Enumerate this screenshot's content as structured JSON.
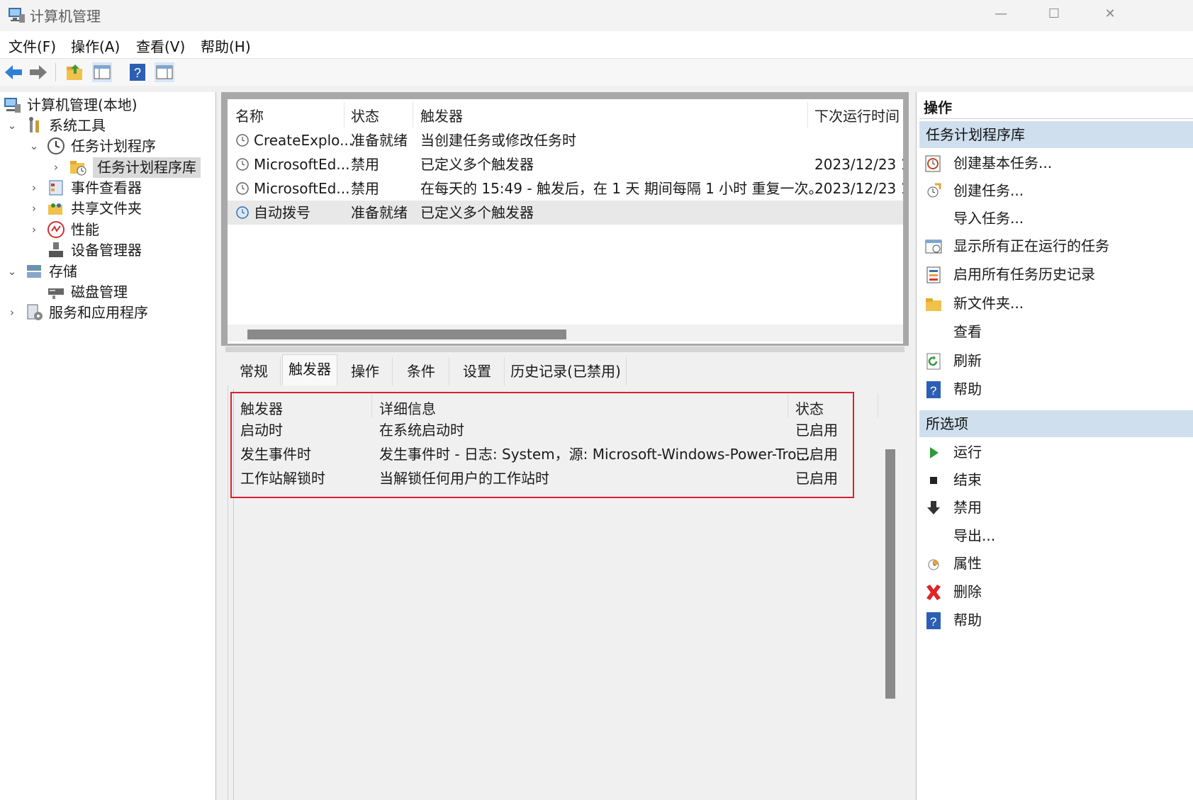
{
  "window": {
    "title": "计算机管理",
    "min": "—",
    "max": "☐",
    "close": "✕"
  },
  "menu": [
    "文件(F)",
    "操作(A)",
    "查看(V)",
    "帮助(H)"
  ],
  "tree": [
    {
      "label": "计算机管理(本地)",
      "icon": "computer-management-icon"
    },
    {
      "label": "系统工具",
      "icon": "tools-icon",
      "chevron": "⌄"
    },
    {
      "label": "任务计划程序",
      "icon": "clock-icon",
      "chevron": "⌄"
    },
    {
      "label": "任务计划程序库",
      "icon": "folder-clock-icon",
      "chevron": "›",
      "selected": true
    },
    {
      "label": "事件查看器",
      "icon": "event-viewer-icon",
      "chevron": "›"
    },
    {
      "label": "共享文件夹",
      "icon": "shared-folder-icon",
      "chevron": "›"
    },
    {
      "label": "性能",
      "icon": "performance-icon",
      "chevron": "›"
    },
    {
      "label": "设备管理器",
      "icon": "device-manager-icon"
    },
    {
      "label": "存储",
      "icon": "storage-icon",
      "chevron": "⌄"
    },
    {
      "label": "磁盘管理",
      "icon": "disk-management-icon"
    },
    {
      "label": "服务和应用程序",
      "icon": "services-icon",
      "chevron": "›"
    }
  ],
  "tasks": {
    "columns": [
      "名称",
      "状态",
      "触发器",
      "下次运行时间"
    ],
    "rows": [
      {
        "name": "CreateExplo...",
        "status": "准备就绪",
        "trigger": "当创建任务或修改任务时",
        "next": ""
      },
      {
        "name": "MicrosoftEd...",
        "status": "禁用",
        "trigger": "已定义多个触发器",
        "next": "2023/12/23 1"
      },
      {
        "name": "MicrosoftEd...",
        "status": "禁用",
        "trigger": "在每天的 15:49 - 触发后，在 1 天 期间每隔 1 小时 重复一次。",
        "next": "2023/12/23 1"
      },
      {
        "name": "自动拨号",
        "status": "准备就绪",
        "trigger": "已定义多个触发器",
        "next": "",
        "selected": true
      }
    ]
  },
  "tabs": [
    "常规",
    "触发器",
    "操作",
    "条件",
    "设置",
    "历史记录(已禁用)"
  ],
  "active_tab": "触发器",
  "triggers": {
    "columns": [
      "触发器",
      "详细信息",
      "状态"
    ],
    "rows": [
      {
        "trigger": "启动时",
        "details": "在系统启动时",
        "status": "已启用"
      },
      {
        "trigger": "发生事件时",
        "details": "发生事件时 - 日志: System，源: Microsoft-Windows-Power-Tro...",
        "status": "已启用"
      },
      {
        "trigger": "工作站解锁时",
        "details": "当解锁任何用户的工作站时",
        "status": "已启用"
      }
    ]
  },
  "actions": {
    "header": "操作",
    "section1": {
      "title": "任务计划程序库",
      "items": [
        {
          "label": "创建基本任务...",
          "icon": "create-basic-task-icon"
        },
        {
          "label": "创建任务...",
          "icon": "create-task-icon"
        },
        {
          "label": "导入任务...",
          "icon": ""
        },
        {
          "label": "显示所有正在运行的任务",
          "icon": "running-tasks-icon"
        },
        {
          "label": "启用所有任务历史记录",
          "icon": "history-icon"
        },
        {
          "label": "新文件夹...",
          "icon": "new-folder-icon"
        },
        {
          "label": "查看",
          "icon": ""
        },
        {
          "label": "刷新",
          "icon": "refresh-icon"
        },
        {
          "label": "帮助",
          "icon": "help-icon"
        }
      ]
    },
    "section2": {
      "title": "所选项",
      "items": [
        {
          "label": "运行",
          "icon": "run-icon"
        },
        {
          "label": "结束",
          "icon": "stop-icon"
        },
        {
          "label": "禁用",
          "icon": "disable-icon"
        },
        {
          "label": "导出...",
          "icon": ""
        },
        {
          "label": "属性",
          "icon": "properties-icon"
        },
        {
          "label": "删除",
          "icon": "delete-icon"
        },
        {
          "label": "帮助",
          "icon": "help-icon"
        }
      ]
    }
  },
  "colors": {
    "highlight_box": "#d8232a",
    "section_bg": "#cfdfee",
    "selected_bg": "#d9d9d9"
  }
}
